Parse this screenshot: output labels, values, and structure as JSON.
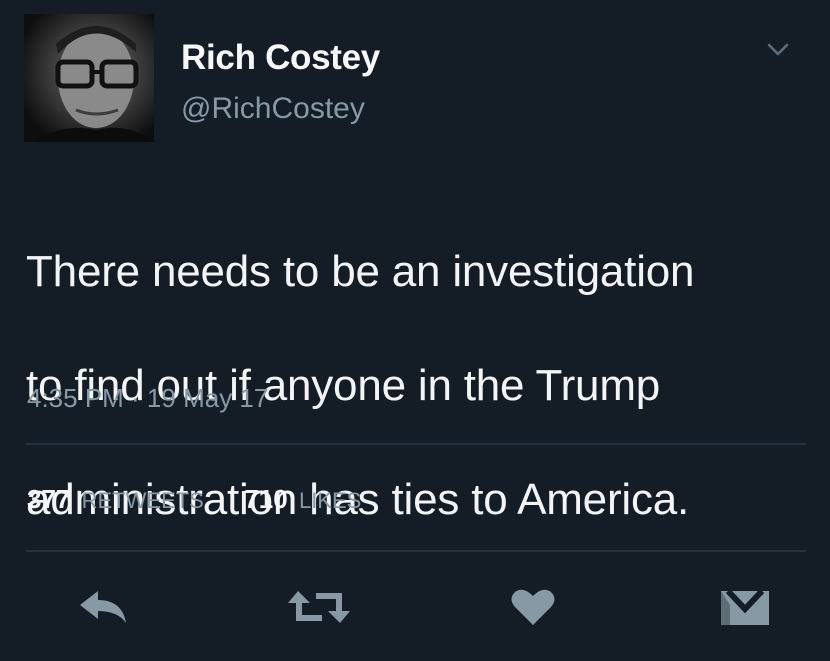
{
  "user": {
    "display_name": "Rich Costey",
    "handle": "@RichCostey"
  },
  "tweet": {
    "text_lines": [
      "There needs to be an investigation",
      "to find out if anyone in the Trump",
      "administration has ties to America."
    ],
    "timestamp": "4:35 PM · 19 May 17"
  },
  "stats": {
    "retweets_count": "377",
    "retweets_label": "RETWEETS",
    "likes_count": "710",
    "likes_label": "LIKES"
  },
  "icons": {
    "menu": "chevron-down-icon",
    "reply": "reply-icon",
    "retweet": "retweet-icon",
    "like": "heart-icon",
    "message": "envelope-icon"
  },
  "colors": {
    "background": "#141d26",
    "text": "#f2f4f6",
    "secondary_text": "#8899a6",
    "divider": "#243240",
    "icon": "#8899a6"
  }
}
